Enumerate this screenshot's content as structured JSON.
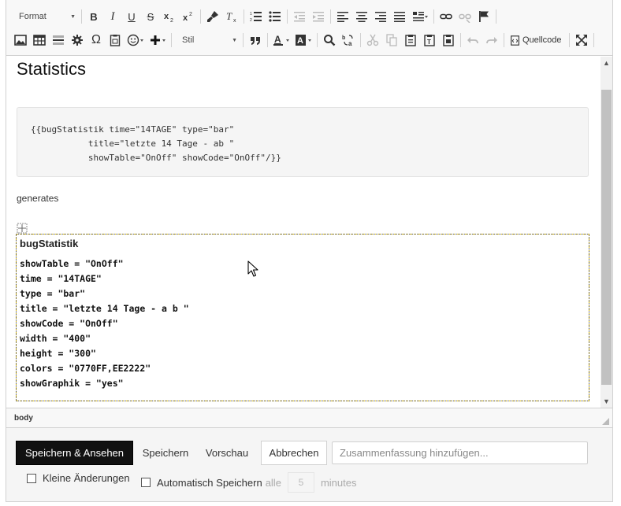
{
  "toolbar": {
    "format_label": "Format",
    "style_label": "Stil",
    "source_label": "Quellcode",
    "bold_glyph": "B",
    "italic_glyph": "I",
    "underline_glyph": "U",
    "strike_glyph": "S",
    "quote_glyph": "99"
  },
  "content": {
    "title": "Statistics",
    "code_block": "{{bugStatistik time=\"14TAGE\" type=\"bar\"\n           title=\"letzte 14 Tage - ab \"\n           showTable=\"OnOff\" showCode=\"OnOff\"/}}",
    "paragraph": "generates",
    "widget": {
      "title": "bugStatistik",
      "lines": [
        "showTable = \"OnOff\"",
        "time = \"14TAGE\"",
        "type = \"bar\"",
        "title = \"letzte 14 Tage - a b \"",
        "showCode = \"OnOff\"",
        "width = \"400\"",
        "height = \"300\"",
        "colors = \"0770FF,EE2222\"",
        "showGraphik = \"yes\""
      ]
    }
  },
  "path_bar": {
    "element": "body"
  },
  "form": {
    "save_view_label": "Speichern & Ansehen",
    "save_label": "Speichern",
    "preview_label": "Vorschau",
    "cancel_label": "Abbrechen",
    "summary_placeholder": "Zusammenfassung hinzufügen...",
    "minor_changes_label": "Kleine Änderungen",
    "autosave_label": "Automatisch Speichern",
    "every_label": "alle",
    "autosave_interval": "5",
    "minutes_label": "minutes"
  }
}
